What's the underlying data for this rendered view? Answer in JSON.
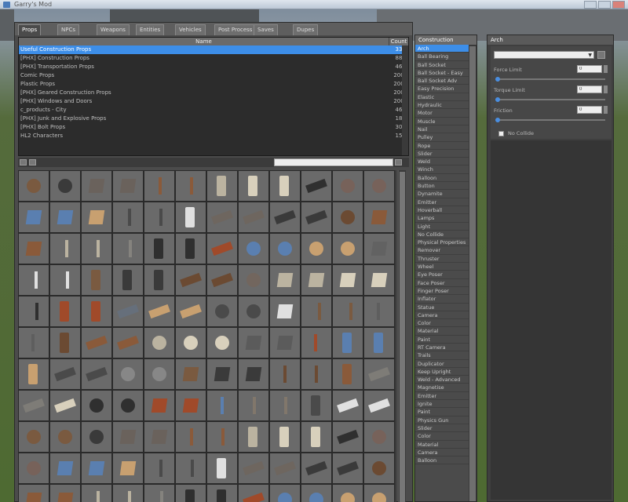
{
  "window": {
    "title": "Garry's Mod"
  },
  "main_panel": {
    "tabs": [
      {
        "label": "Props"
      },
      {
        "label": "NPCs"
      },
      {
        "label": "Weapons"
      },
      {
        "label": "Entities"
      },
      {
        "label": "Vehicles"
      },
      {
        "label": "Post Process"
      },
      {
        "label": "Saves"
      },
      {
        "label": "Dupes"
      }
    ],
    "list": {
      "header_name": "Name",
      "header_count": "Count",
      "rows": [
        {
          "name": "Useful Construction Props",
          "count": "33",
          "selected": true
        },
        {
          "name": "[PHX] Construction Props",
          "count": "88",
          "selected": false
        },
        {
          "name": "[PHX] Transportation Props",
          "count": "46",
          "selected": false
        },
        {
          "name": "Comic Props",
          "count": "200",
          "selected": false
        },
        {
          "name": "Plastic Props",
          "count": "200",
          "selected": false
        },
        {
          "name": "[PHX] Geared Construction Props",
          "count": "200",
          "selected": false
        },
        {
          "name": "[PHX] Windows and Doors",
          "count": "200",
          "selected": false
        },
        {
          "name": "c_products - City",
          "count": "46",
          "selected": false
        },
        {
          "name": "[PHX] Junk and Explosive Props",
          "count": "18",
          "selected": false
        },
        {
          "name": "[PHX] Bolt Props",
          "count": "30",
          "selected": false
        },
        {
          "name": "HL2 Characters",
          "count": "15",
          "selected": false
        }
      ]
    },
    "filter_placeholder": ""
  },
  "categories": {
    "header": "Construction",
    "items": [
      "Arch",
      "Ball Bearing",
      "Ball Socket",
      "Ball Socket - Easy",
      "Ball Socket Adv",
      "Easy Precision",
      "Elastic",
      "Hydraulic",
      "Motor",
      "Muscle",
      "Nail",
      "Pulley",
      "Rope",
      "Slider",
      "Weld",
      "Winch",
      "Balloon",
      "Button",
      "Dynamite",
      "Emitter",
      "Hoverball",
      "Lamps",
      "Light",
      "No Collide",
      "Physical Properties",
      "Remover",
      "Thruster",
      "Wheel",
      "Eye Poser",
      "Face Poser",
      "Finger Poser",
      "Inflator",
      "Statue",
      "Camera",
      "Color",
      "Material",
      "Paint",
      "RT Camera",
      "Trails",
      "Duplicator",
      "Keep Upright",
      "Weld - Advanced",
      "Magnetise",
      "Emitter",
      "Ignite",
      "Paint",
      "Physics Gun",
      "Slider",
      "Color",
      "Material",
      "Camera",
      "Balloon"
    ]
  },
  "properties": {
    "header": "Arch",
    "combo_value": "",
    "fields": [
      {
        "label": "Force Limit",
        "value": "0"
      },
      {
        "label": "Torque Limit",
        "value": "0"
      },
      {
        "label": "Friction",
        "value": "0"
      }
    ],
    "checkbox_label": "No Collide"
  },
  "colors": {
    "selection": "#3d8ee8",
    "panel": "#4b4b4b",
    "list_bg": "#2c2c2c"
  }
}
